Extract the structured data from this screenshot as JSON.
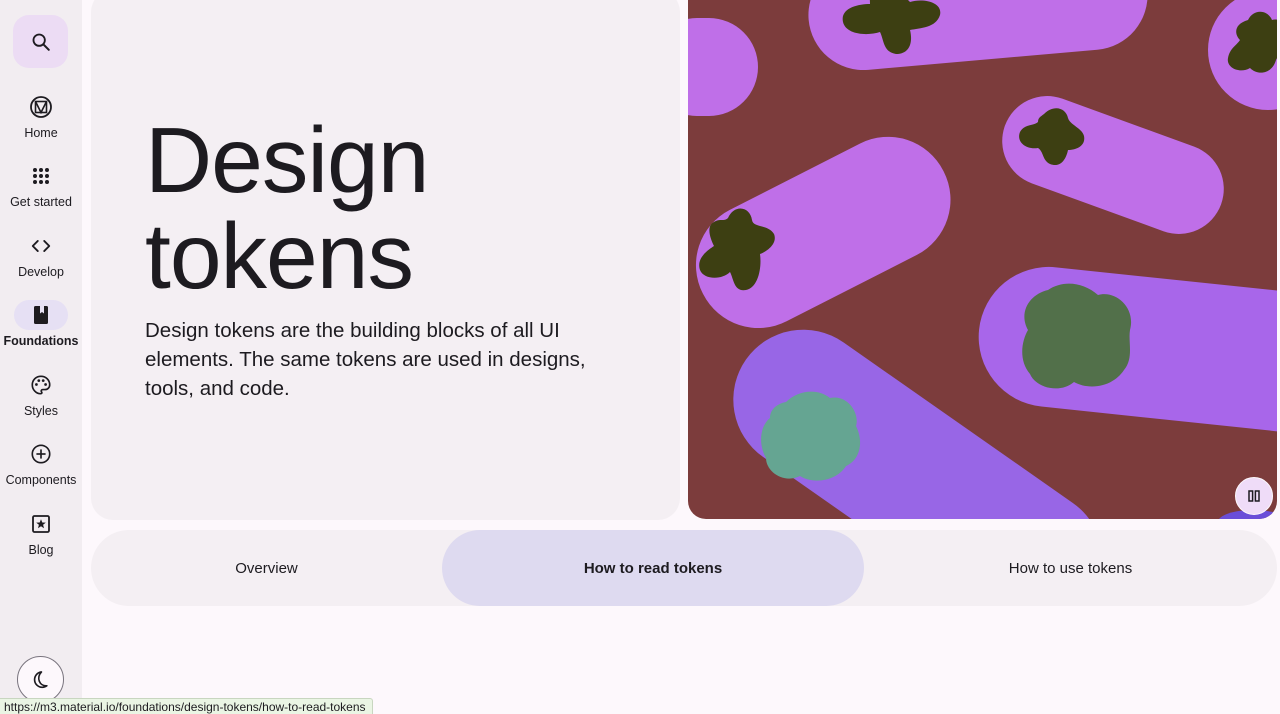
{
  "nav": {
    "items": [
      {
        "label": "Home",
        "icon": "material-logo-icon"
      },
      {
        "label": "Get started",
        "icon": "apps-grid-icon"
      },
      {
        "label": "Develop",
        "icon": "code-icon"
      },
      {
        "label": "Foundations",
        "icon": "book-icon",
        "active": true
      },
      {
        "label": "Styles",
        "icon": "palette-icon"
      },
      {
        "label": "Components",
        "icon": "add-circle-icon"
      },
      {
        "label": "Blog",
        "icon": "star-box-icon"
      }
    ]
  },
  "hero": {
    "title_line1": "Design",
    "title_line2": "tokens",
    "description": "Design tokens are the building blocks of all UI elements. The same tokens are used in designs, tools, and code."
  },
  "tabs": [
    {
      "label": "Overview"
    },
    {
      "label": "How to read tokens",
      "active": true
    },
    {
      "label": "How to use tokens"
    }
  ],
  "status_url": "https://m3.material.io/foundations/design-tokens/how-to-read-tokens",
  "colors": {
    "rail_bg": "#f2edf1",
    "active_pill": "#e6e0f4",
    "hero_card": "#f4eff3",
    "illustration_bg": "#7c3c3c",
    "purple": "#bf6fe8",
    "violet": "#9866e6",
    "olive": "#3d3f12",
    "green": "#52704a",
    "teal": "#65a592",
    "active_tab": "#dedaf0"
  }
}
